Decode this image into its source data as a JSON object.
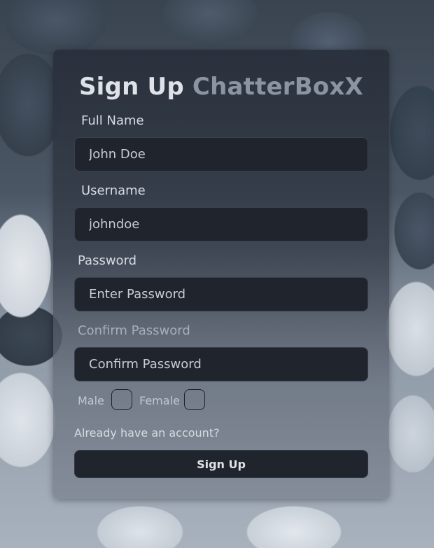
{
  "title": {
    "main": "Sign Up",
    "brand": "ChatterBoxX"
  },
  "form": {
    "full_name": {
      "label": "Full Name",
      "value": "John Doe",
      "placeholder": ""
    },
    "username": {
      "label": "Username",
      "value": "johndoe",
      "placeholder": ""
    },
    "password": {
      "label": "Password",
      "value": "",
      "placeholder": "Enter Password"
    },
    "confirm_password": {
      "label": "Confirm Password",
      "value": "",
      "placeholder": "Confirm Password"
    },
    "gender": {
      "male_label": "Male",
      "female_label": "Female",
      "male_checked": false,
      "female_checked": false
    },
    "login_link": "Already have an account?",
    "submit_label": "Sign Up"
  },
  "colors": {
    "card_bg": "#282f3a",
    "input_bg": "#1f242d",
    "brand_text": "#8b95a2"
  }
}
